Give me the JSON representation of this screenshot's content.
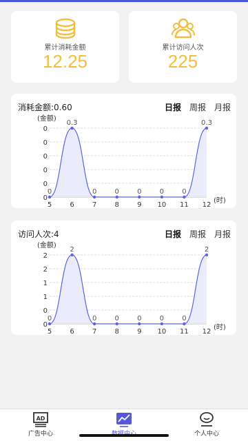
{
  "stats": [
    {
      "label": "累计消耗金额",
      "value": "12.25",
      "icon": "coins-icon"
    },
    {
      "label": "累计访问人次",
      "value": "225",
      "icon": "users-icon"
    }
  ],
  "charts": [
    {
      "title": "消耗金额:0.60",
      "unit": "(金额)",
      "tabs": [
        "日报",
        "周报",
        "月报"
      ],
      "active_tab": 0
    },
    {
      "title": "访问人次:4",
      "unit": "(金额)",
      "tabs": [
        "日报",
        "周报",
        "月报"
      ],
      "active_tab": 0
    }
  ],
  "chart_data": [
    {
      "type": "area",
      "x": [
        "5",
        "6",
        "7",
        "8",
        "9",
        "10",
        "11",
        "12"
      ],
      "x_unit": "(时)",
      "values": [
        0,
        0.3,
        0,
        0,
        0,
        0,
        0,
        0.3
      ],
      "data_labels": [
        "0",
        "0.3",
        "0",
        "0",
        "0",
        "0",
        "0",
        "0.3"
      ],
      "y_ticks": [
        "0",
        "0",
        "0",
        "0",
        "0",
        "0"
      ],
      "ylim": [
        0,
        0.3
      ],
      "ylabel": "(金额)",
      "grid": true,
      "color": "#5b63e6"
    },
    {
      "type": "area",
      "x": [
        "5",
        "6",
        "7",
        "8",
        "9",
        "10",
        "11",
        "12"
      ],
      "x_unit": "(时)",
      "values": [
        0,
        2,
        0,
        0,
        0,
        0,
        0,
        2
      ],
      "data_labels": [
        "0",
        "2",
        "0",
        "0",
        "0",
        "0",
        "0",
        "2"
      ],
      "y_ticks": [
        "0",
        "0",
        "1",
        "1",
        "2",
        "2"
      ],
      "ylim": [
        0,
        2
      ],
      "ylabel": "(金额)",
      "grid": true,
      "color": "#5b63e6"
    }
  ],
  "tabbar": {
    "items": [
      {
        "label": "广告中心",
        "icon": "ad-icon"
      },
      {
        "label": "数据中心",
        "icon": "chart-trend-icon"
      },
      {
        "label": "个人中心",
        "icon": "profile-icon"
      }
    ],
    "active": 1,
    "accent": "#5558d8"
  }
}
